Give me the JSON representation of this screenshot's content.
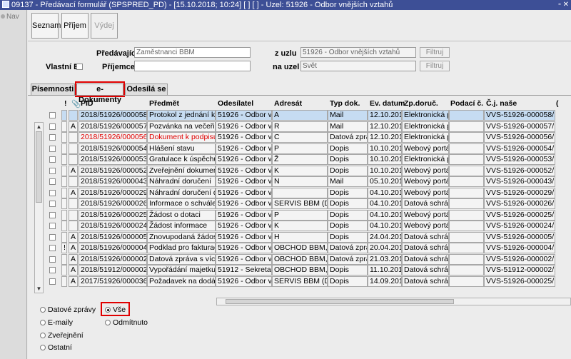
{
  "window": {
    "title": "09137 - Předávací formulář (SPSPRED_PD) - [15.10.2018; 10:24]  [ ] [ ] - Uzel: 51926 - Odbor vnějších vztahů",
    "controls": "▫ ✕"
  },
  "side": {
    "nav_label": "Nav"
  },
  "toolbar": {
    "seznam": "Seznam",
    "prijem": "Příjem",
    "vydej": "Výdej"
  },
  "form": {
    "predavajici_label": "Předávající",
    "predavajici_value": "Zaměstnanci BBM",
    "z_uzlu_label": "z uzlu",
    "z_uzlu_value": "51926 - Odbor vnějších vztahů",
    "filtruj1": "Filtruj",
    "vlastni_ej_label": "Vlastní EJ",
    "prijemce_label": "Příjemce",
    "prijemce_value": "",
    "na_uzel_label": "na uzel",
    "na_uzel_value": "Svět",
    "filtruj2": "Filtruj"
  },
  "tabs": [
    "Písemnosti",
    "e-Dokumenty",
    "Odesílá se"
  ],
  "table": {
    "headers": {
      "excl": "!",
      "attach": "📎",
      "pid": "PID",
      "predmet": "Předmět",
      "odesilatel": "Odesílatel",
      "adresat": "Adresát",
      "typ": "Typ dok.",
      "datum": "Ev. datum",
      "doruc": "Zp.doruč.",
      "podaci": "Podací č.",
      "cj": "Č.j. naše",
      "more": "("
    },
    "rows": [
      {
        "flag": "",
        "a": "",
        "pid": "2018/51926/000058",
        "predmet": "Protokol z jednání komis",
        "odes": "51926 - Odbor vnějš",
        "adr": "A",
        "typ": "Mail",
        "datum": "12.10.2018",
        "doruc": "Elektronická poš",
        "podaci": "",
        "cj": "VVS-51926-000058/18"
      },
      {
        "flag": "",
        "a": "A",
        "pid": "2018/51926/000057",
        "predmet": "Pozvánka na večeři",
        "odes": "51926 - Odbor vnějš",
        "adr": "R",
        "typ": "Mail",
        "datum": "12.10.2018",
        "doruc": "Elektronická poš",
        "podaci": "",
        "cj": "VVS-51926-000057/18"
      },
      {
        "flag": "",
        "a": "",
        "pid": "2018/51926/000056",
        "predmet": "Dokument k podpisu",
        "odes": "51926 - Odbor vnějš",
        "adr": "C",
        "typ": "Datová zpráva",
        "datum": "12.10.2018",
        "doruc": "Elektronická poš",
        "podaci": "",
        "cj": "VVS-51926-000056/18"
      },
      {
        "flag": "",
        "a": "",
        "pid": "2018/51926/000054",
        "predmet": "Hlášení stavu",
        "odes": "51926 - Odbor vnějš",
        "adr": "P",
        "typ": "Dopis",
        "datum": "10.10.2018",
        "doruc": "Webový portál",
        "podaci": "",
        "cj": "VVS-51926-000054/18"
      },
      {
        "flag": "",
        "a": "",
        "pid": "2018/51926/000053",
        "predmet": "Gratulace k úspěchu",
        "odes": "51926 - Odbor vnějš",
        "adr": "Ž",
        "typ": "Dopis",
        "datum": "10.10.2018",
        "doruc": "Elektronická poš",
        "podaci": "",
        "cj": "VVS-51926-000053/18"
      },
      {
        "flag": "",
        "a": "A",
        "pid": "2018/51926/000052",
        "predmet": "Zveřejnění dokumentu",
        "odes": "51926 - Odbor vnějš",
        "adr": "K",
        "typ": "Dopis",
        "datum": "10.10.2018",
        "doruc": "Webový portál",
        "podaci": "",
        "cj": "VVS-51926-000052/18"
      },
      {
        "flag": "",
        "a": "",
        "pid": "2018/51926/000043",
        "predmet": "Náhradní doručení",
        "odes": "51926 - Odbor vnějš",
        "adr": "N",
        "typ": "Mail",
        "datum": "05.10.2018",
        "doruc": "Webový portál",
        "podaci": "",
        "cj": "VVS-51926-000043/18"
      },
      {
        "flag": "",
        "a": "A",
        "pid": "2018/51926/000029",
        "predmet": "Náhradní doručení doda",
        "odes": "51926 - Odbor vnějš",
        "adr": "",
        "typ": "Dopis",
        "datum": "04.10.2018",
        "doruc": "Webový portál",
        "podaci": "",
        "cj": "VVS-51926-000029/18"
      },
      {
        "flag": "",
        "a": "",
        "pid": "2018/51926/000026",
        "predmet": "Informace o schválení",
        "odes": "51926 - Odbor vnějš",
        "adr": "SERVIS BBM   (DS=",
        "typ": "Dopis",
        "datum": "04.10.2018",
        "doruc": "Datová schránk",
        "podaci": "",
        "cj": "VVS-51926-000026/18"
      },
      {
        "flag": "",
        "a": "",
        "pid": "2018/51926/000025",
        "predmet": "Žádost o dotaci",
        "odes": "51926 - Odbor vnějš",
        "adr": "P",
        "typ": "Dopis",
        "datum": "04.10.2018",
        "doruc": "Webový portál",
        "podaci": "",
        "cj": "VVS-51926-000025/18"
      },
      {
        "flag": "",
        "a": "",
        "pid": "2018/51926/000024",
        "predmet": "Žádost informace",
        "odes": "51926 - Odbor vnějš",
        "adr": "K",
        "typ": "Dopis",
        "datum": "04.10.2018",
        "doruc": "Webový portál",
        "podaci": "",
        "cj": "VVS-51926-000024/18"
      },
      {
        "flag": "",
        "a": "A",
        "pid": "2018/51926/000005",
        "predmet": "Znovupodaná žádost",
        "odes": "51926 - Odbor vnějš",
        "adr": "H",
        "typ": "Dopis",
        "datum": "24.04.2018",
        "doruc": "Datová schránk",
        "podaci": "",
        "cj": "VVS-51926-000005/18"
      },
      {
        "flag": "!",
        "a": "A",
        "pid": "2018/51926/000004",
        "predmet": "Podklad pro fakturaci",
        "odes": "51926 - Odbor vnějš",
        "adr": "OBCHOD BBM, s.r.o",
        "typ": "Datová zpráva",
        "datum": "20.04.2018",
        "doruc": "Datová schránk",
        "podaci": "",
        "cj": "VVS-51926-000004/18"
      },
      {
        "flag": "",
        "a": "A",
        "pid": "2018/51926/000002",
        "predmet": "Datová zpráva s více př",
        "odes": "51926 - Odbor vnějš",
        "adr": "OBCHOD BBM, s.r.o",
        "typ": "Datová zpráva",
        "datum": "21.03.2018",
        "doruc": "Datová schránk",
        "podaci": "",
        "cj": "VVS-51926-000002/18"
      },
      {
        "flag": "",
        "a": "A",
        "pid": "2018/51912/000002",
        "predmet": "Vypořádání majetku",
        "odes": "51912 - Sekretariát",
        "adr": "OBCHOD BBM, s.r.o",
        "typ": "Dopis",
        "datum": "11.10.2018",
        "doruc": "Datová schránk",
        "podaci": "",
        "cj": "VVS-51912-000002/18"
      },
      {
        "flag": "",
        "a": "A",
        "pid": "2017/51926/000036",
        "predmet": "Požadavek na dodání ir",
        "odes": "51926 - Odbor vnějš",
        "adr": "SERVIS BBM   (DS=",
        "typ": "Dopis",
        "datum": "14.09.2017",
        "doruc": "Datová schránk",
        "podaci": "",
        "cj": "VVS-51926-000025/17"
      }
    ]
  },
  "filters": {
    "datove_zpravy": "Datové zprávy",
    "emaily": "E-maily",
    "zverejneni": "Zveřejnění",
    "ostatni": "Ostatní",
    "vse": "Vše",
    "odmitnuto": "Odmítnuto",
    "selected": "Vše"
  },
  "colors": {
    "titlebar": "#3d4f96",
    "selection": "#c6dcf2",
    "highlight": "#e00000"
  }
}
